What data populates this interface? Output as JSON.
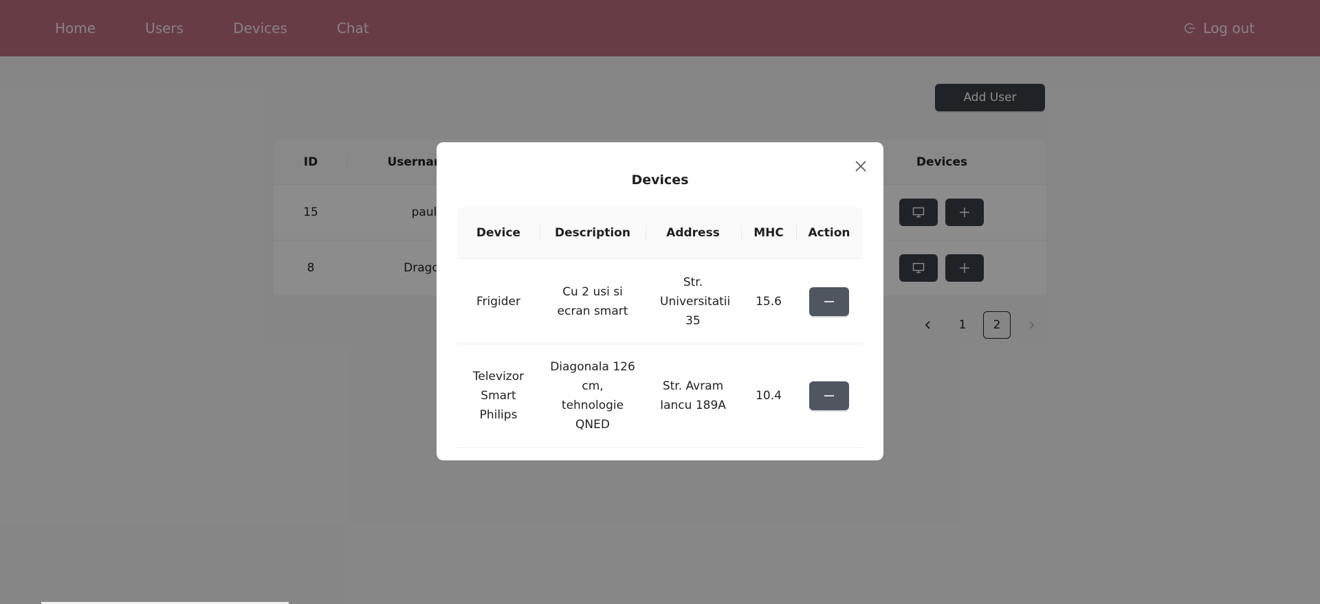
{
  "nav": {
    "links": [
      "Home",
      "Users",
      "Devices",
      "Chat"
    ],
    "logout": "Log out"
  },
  "page": {
    "add_user_label": "Add User",
    "table": {
      "headers": {
        "id": "ID",
        "username": "Usernam",
        "devices": "Devices"
      },
      "rows": [
        {
          "id": "15",
          "username": "paul"
        },
        {
          "id": "8",
          "username": "Drago"
        }
      ]
    },
    "pagination": {
      "pages": [
        "1",
        "2"
      ],
      "current": "2"
    }
  },
  "modal": {
    "title": "Devices",
    "headers": [
      "Device",
      "Description",
      "Address",
      "MHC",
      "Action"
    ],
    "rows": [
      {
        "device": "Frigider",
        "description": "Cu 2 usi si ecran smart",
        "address": "Str. Universitatii 35",
        "mhc": "15.6"
      },
      {
        "device": "Televizor Smart Philips",
        "description": "Diagonala 126 cm, tehnologie QNED",
        "address": "Str. Avram Iancu 189A",
        "mhc": "10.4"
      }
    ]
  },
  "colors": {
    "navbar": "#bd6d7e",
    "button_dark": "#3a3f47",
    "remove_button": "#505660"
  },
  "icons": {
    "logout": "logout-icon",
    "close": "close-icon",
    "monitor": "monitor-icon",
    "plus": "plus-icon",
    "minus": "minus-icon",
    "prev": "chevron-left-icon",
    "next": "chevron-right-icon"
  }
}
